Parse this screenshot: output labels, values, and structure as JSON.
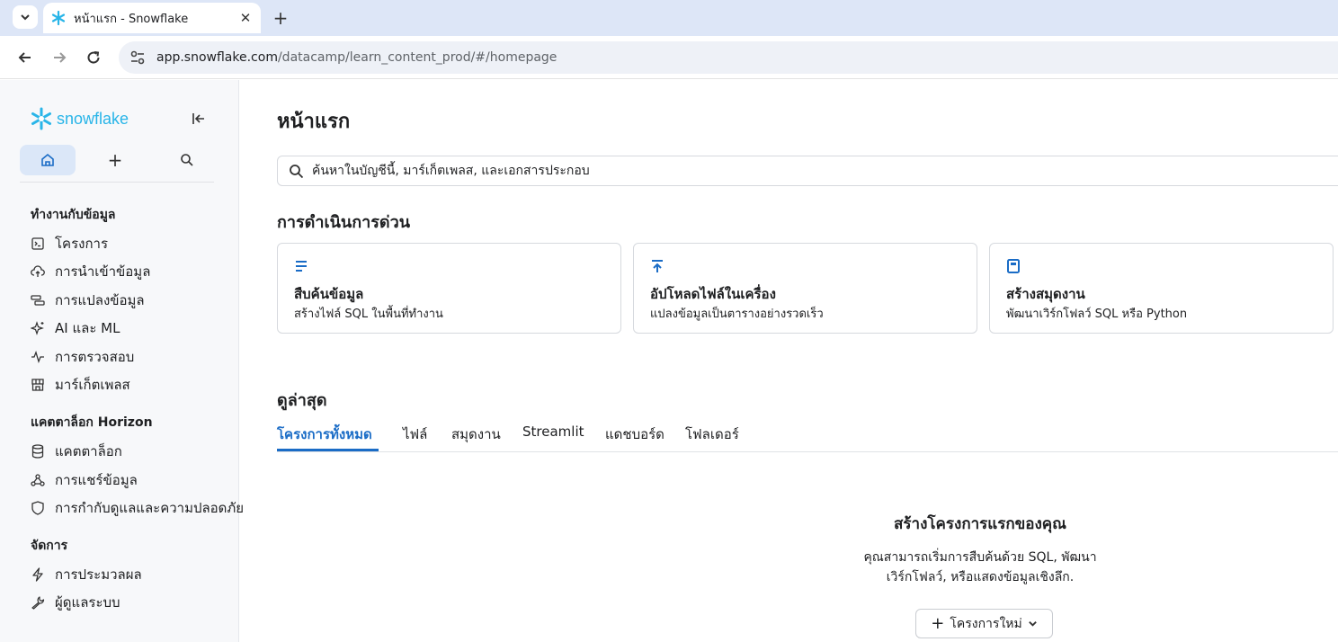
{
  "browser": {
    "tab_title": "หน้าแรก - Snowflake",
    "url_host": "app.snowflake.com",
    "url_path": "/datacamp/learn_content_prod/#/homepage"
  },
  "sidebar": {
    "logo_text": "snowflake",
    "sections": [
      {
        "title": "ทำงานกับข้อมูล",
        "items": [
          {
            "label": "โครงการ",
            "icon": "terminal-icon"
          },
          {
            "label": "การนำเข้าข้อมูล",
            "icon": "cloud-upload-icon"
          },
          {
            "label": "การแปลงข้อมูล",
            "icon": "transform-icon"
          },
          {
            "label": "AI และ ML",
            "icon": "sparkle-icon"
          },
          {
            "label": "การตรวจสอบ",
            "icon": "activity-icon"
          },
          {
            "label": "มาร์เก็ตเพลส",
            "icon": "store-icon"
          }
        ]
      },
      {
        "title": "แคตตาล็อก Horizon",
        "items": [
          {
            "label": "แคตตาล็อก",
            "icon": "database-icon"
          },
          {
            "label": "การแชร์ข้อมูล",
            "icon": "share-icon"
          },
          {
            "label": "การกำกับดูแลและความปลอดภัย",
            "icon": "shield-icon"
          }
        ]
      },
      {
        "title": "จัดการ",
        "items": [
          {
            "label": "การประมวลผล",
            "icon": "lightning-icon"
          },
          {
            "label": "ผู้ดูแลระบบ",
            "icon": "wrench-icon"
          }
        ]
      }
    ]
  },
  "main": {
    "title": "หน้าแรก",
    "search_placeholder": "ค้นหาในบัญชีนี้, มาร์เก็ตเพลส, และเอกสารประกอบ",
    "quick_actions_title": "การดำเนินการด่วน",
    "quick_actions": [
      {
        "title": "สืบค้นข้อมูล",
        "subtitle": "สร้างไฟล์ SQL ในพื้นที่ทำงาน",
        "icon": "lines-icon"
      },
      {
        "title": "อัปโหลดไฟล์ในเครื่อง",
        "subtitle": "แปลงข้อมูลเป็นตารางอย่างรวดเร็ว",
        "icon": "upload-icon"
      },
      {
        "title": "สร้างสมุดงาน",
        "subtitle": "พัฒนาเวิร์กโฟลว์ SQL หรือ Python",
        "icon": "notebook-icon"
      }
    ],
    "recent_title": "ดูล่าสุด",
    "tabs": [
      "โครงการทั้งหมด",
      "ไฟล์",
      "สมุดงาน",
      "Streamlit",
      "แดชบอร์ด",
      "โฟลเดอร์"
    ],
    "empty_title": "สร้างโครงการแรกของคุณ",
    "empty_desc_line1": "คุณสามารถเริ่มการสืบค้นด้วย SQL, พัฒนา",
    "empty_desc_line2": "เวิร์กโฟลว์, หรือแสดงข้อมูลเชิงลึก.",
    "new_button": "โครงการใหม่"
  },
  "colors": {
    "accent": "#1a6cc6",
    "brand": "#29b5e8"
  }
}
